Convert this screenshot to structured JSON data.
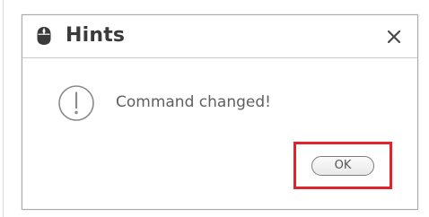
{
  "dialog": {
    "title": "Hints",
    "app_icon": "mouse-icon",
    "close_icon": "close-icon",
    "message_icon": "exclamation-circle-icon",
    "message": "Command changed!",
    "ok_label": "OK"
  },
  "colors": {
    "highlight": "#e0242b",
    "title_text": "#3a3a3a",
    "message_text": "#5f5f5f",
    "border": "#a9a9a9"
  }
}
